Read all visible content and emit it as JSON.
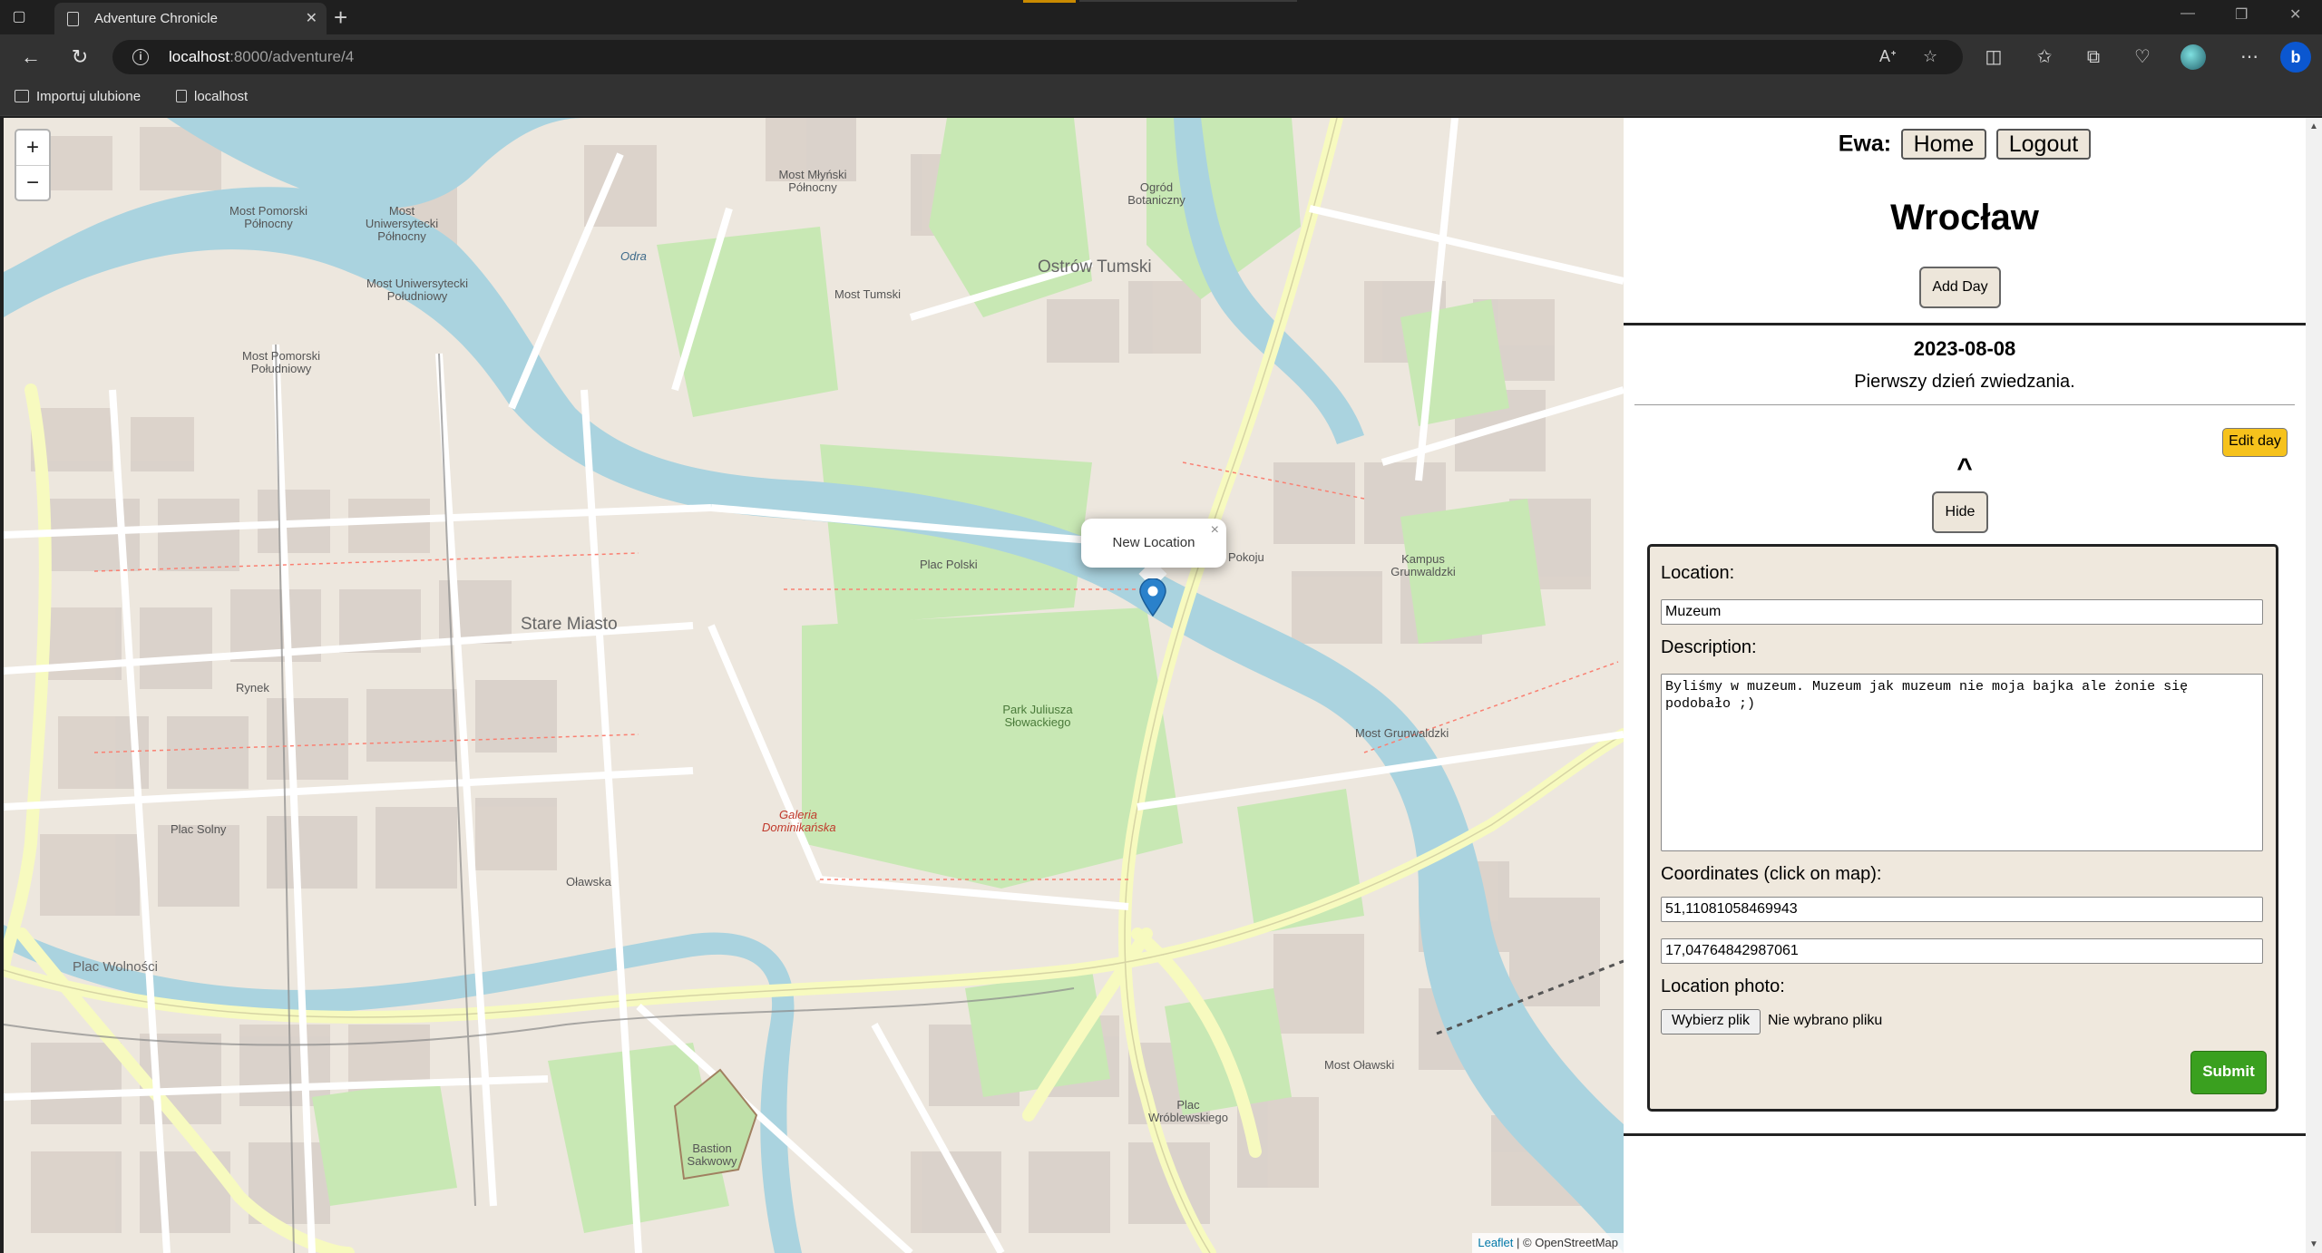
{
  "browser": {
    "tab_title": "Adventure Chronicle",
    "url_host": "localhost",
    "url_path": ":8000/adventure/4",
    "bookmarks": [
      "Importuj ulubione",
      "localhost"
    ]
  },
  "map": {
    "zoom_in": "+",
    "zoom_out": "−",
    "popup_text": "New Location",
    "popup_close": "×",
    "attribution_leaflet": "Leaflet",
    "attribution_rest": "| © OpenStreetMap",
    "labels": {
      "stare_miasto": "Stare Miasto",
      "rynek": "Rynek",
      "plac_solny": "Plac Solny",
      "ostrow_tumski": "Ostrów Tumski",
      "ogrod_botaniczny": "Ogród Botaniczny",
      "most_pomorski_polnocny": "Most Pomorski Północny",
      "most_uniwersytecki_polnocny": "Most Uniwersytecki Północny",
      "most_uniwersytecki_poludniowy": "Most Uniwersytecki Południowy",
      "most_pomorski_poludniowy": "Most Pomorski Południowy",
      "most_mlynski": "Most Młyński Północny",
      "most_tumski": "Most Tumski",
      "most_pokoju": "Pokoju",
      "most_grunwaldzki": "Most Grunwaldzki",
      "most_olawski": "Most Oławski",
      "plac_polski": "Plac Polski",
      "park_slowackiego": "Park Juliusza Słowackiego",
      "galeria_dominikanska": "Galeria Dominikańska",
      "kampus_grunwaldzki": "Kampus Grunwaldzki",
      "plac_wolnosci": "Plac Wolności",
      "olawska": "Oławska",
      "odra": "Odra",
      "plac_wroblewskiego": "Plac Wróblewskiego",
      "bastion": "Bastion Sakwowy"
    }
  },
  "panel": {
    "user_name": "Ewa:",
    "home_label": "Home",
    "logout_label": "Logout",
    "title": "Wrocław",
    "add_day_label": "Add Day",
    "day": {
      "date": "2023-08-08",
      "description": "Pierwszy dzień zwiedzania.",
      "edit_label": "Edit day",
      "chevron": "^",
      "hide_label": "Hide"
    },
    "form": {
      "location_label": "Location:",
      "location_value": "Muzeum",
      "description_label": "Description:",
      "description_value": "Byliśmy w muzeum. Muzeum jak muzeum nie moja bajka ale żonie się podobało ;)",
      "coordinates_label": "Coordinates (click on map):",
      "lat_value": "51,11081058469943",
      "lng_value": "17,04764842987061",
      "photo_label": "Location photo:",
      "file_button": "Wybierz plik",
      "file_status": "Nie wybrano pliku",
      "submit_label": "Submit"
    }
  },
  "colors": {
    "submit_green": "#3aa01f",
    "edit_yellow": "#f6c21c",
    "button_beige": "#ede6da",
    "form_bg": "#efe8dd",
    "river": "#aad3df",
    "marker_blue": "#2a81cb"
  }
}
